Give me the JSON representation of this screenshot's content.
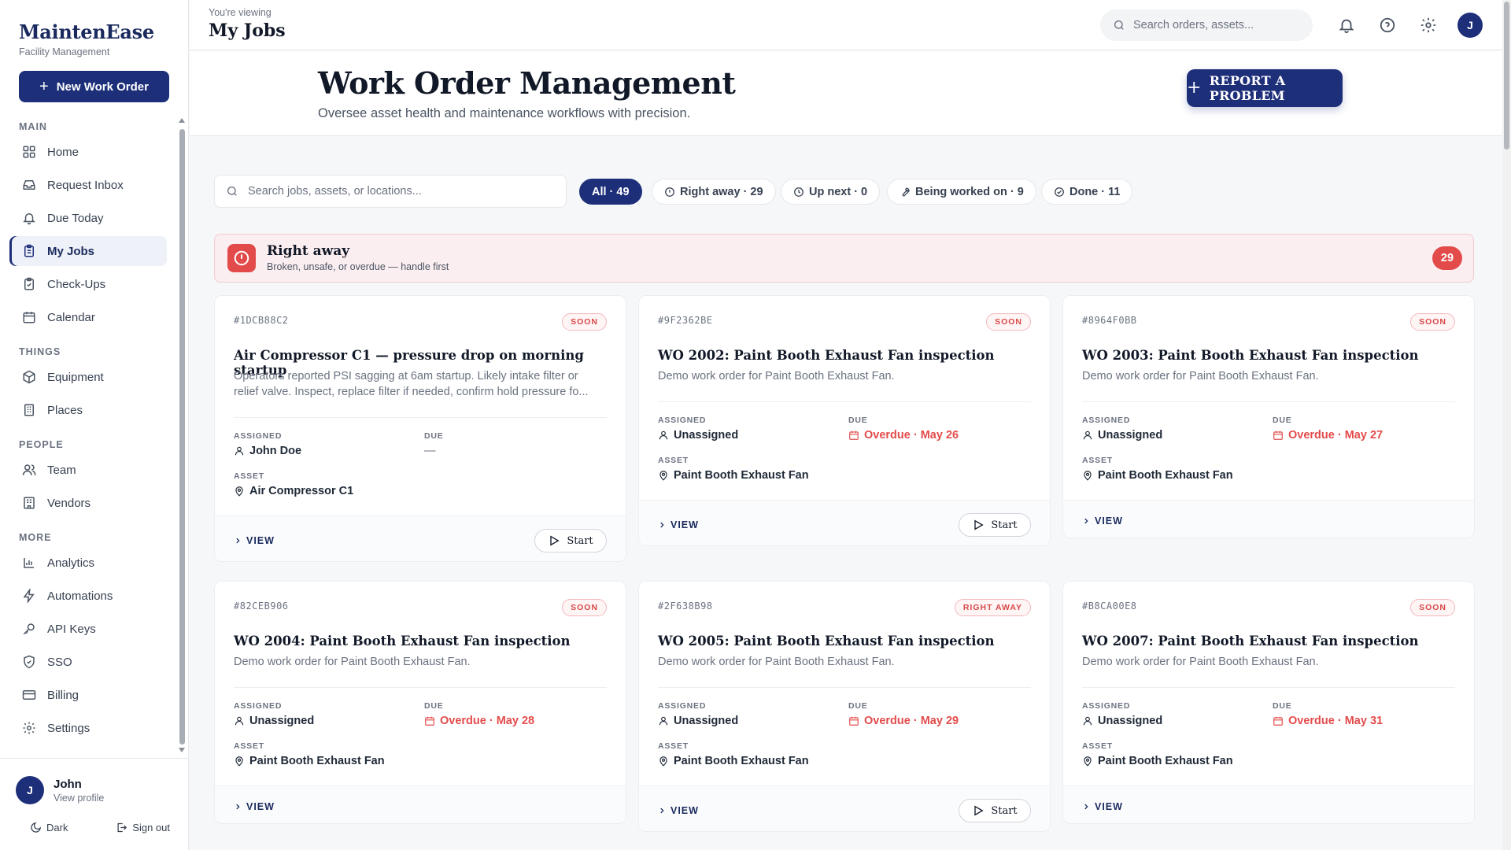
{
  "brand": {
    "name": "MaintenEase",
    "subtitle": "Facility Management"
  },
  "sidebar": {
    "new_button": "New Work Order",
    "sections": [
      {
        "label": "MAIN",
        "items": [
          {
            "label": "Home",
            "icon": "dashboard-grid-icon"
          },
          {
            "label": "Request Inbox",
            "icon": "inbox-icon"
          },
          {
            "label": "Due Today",
            "icon": "bell-icon"
          },
          {
            "label": "My Jobs",
            "icon": "clipboard-icon",
            "active": true
          },
          {
            "label": "Check-Ups",
            "icon": "clipboard-check-icon"
          },
          {
            "label": "Calendar",
            "icon": "calendar-icon"
          }
        ]
      },
      {
        "label": "THINGS",
        "items": [
          {
            "label": "Equipment",
            "icon": "box-icon"
          },
          {
            "label": "Places",
            "icon": "building-icon"
          }
        ]
      },
      {
        "label": "PEOPLE",
        "items": [
          {
            "label": "Team",
            "icon": "users-icon"
          },
          {
            "label": "Vendors",
            "icon": "vendor-building-icon"
          }
        ]
      },
      {
        "label": "MORE",
        "items": [
          {
            "label": "Analytics",
            "icon": "bar-chart-icon"
          },
          {
            "label": "Automations",
            "icon": "lightning-icon"
          },
          {
            "label": "API Keys",
            "icon": "key-icon"
          },
          {
            "label": "SSO",
            "icon": "shield-icon"
          },
          {
            "label": "Billing",
            "icon": "credit-card-icon"
          },
          {
            "label": "Settings",
            "icon": "gear-icon"
          }
        ]
      }
    ],
    "user": {
      "initial": "J",
      "name": "John",
      "link": "View profile"
    },
    "theme_toggle": "Dark",
    "sign_out": "Sign out"
  },
  "topbar": {
    "viewing_label": "You're viewing",
    "page_title": "My Jobs",
    "search_placeholder": "Search orders, assets...",
    "avatar_initial": "J"
  },
  "header": {
    "title": "Work Order Management",
    "subtitle": "Oversee asset health and maintenance workflows with precision.",
    "report_button": "REPORT A PROBLEM"
  },
  "filters": {
    "search_placeholder": "Search jobs, assets, or locations...",
    "pills": [
      {
        "label": "All · 49",
        "active": true
      },
      {
        "label": "Right away · 29",
        "icon": "alert-circle-icon"
      },
      {
        "label": "Up next · 0",
        "icon": "clock-icon"
      },
      {
        "label": "Being worked on · 9",
        "icon": "wrench-icon"
      },
      {
        "label": "Done · 11",
        "icon": "check-circle-icon"
      }
    ]
  },
  "banner": {
    "title": "Right away",
    "subtitle": "Broken, unsafe, or overdue — handle first",
    "count": "29"
  },
  "labels": {
    "assigned": "ASSIGNED",
    "due": "DUE",
    "asset": "ASSET",
    "view": "VIEW",
    "start": "Start"
  },
  "cards": [
    {
      "id": "#1DCB88C2",
      "badge": "SOON",
      "title": "Air Compressor C1 — pressure drop on morning startup",
      "desc": "Operators reported PSI sagging at 6am startup. Likely intake filter or relief valve. Inspect, replace filter if needed, confirm hold pressure fo...",
      "assigned": "John Doe",
      "due": "—",
      "asset": "Air Compressor C1",
      "start": true
    },
    {
      "id": "#9F2362BE",
      "badge": "SOON",
      "title": "WO 2002: Paint Booth Exhaust Fan inspection",
      "desc": "Demo work order for Paint Booth Exhaust Fan.",
      "assigned": "Unassigned",
      "due": "Overdue · May 26",
      "asset": "Paint Booth Exhaust Fan",
      "start": true
    },
    {
      "id": "#8964F0BB",
      "badge": "SOON",
      "title": "WO 2003: Paint Booth Exhaust Fan inspection",
      "desc": "Demo work order for Paint Booth Exhaust Fan.",
      "assigned": "Unassigned",
      "due": "Overdue · May 27",
      "asset": "Paint Booth Exhaust Fan",
      "start": false
    },
    {
      "id": "#82CEB906",
      "badge": "SOON",
      "title": "WO 2004: Paint Booth Exhaust Fan inspection",
      "desc": "Demo work order for Paint Booth Exhaust Fan.",
      "assigned": "Unassigned",
      "due": "Overdue · May 28",
      "asset": "Paint Booth Exhaust Fan",
      "start": false
    },
    {
      "id": "#2F638B98",
      "badge": "RIGHT AWAY",
      "title": "WO 2005: Paint Booth Exhaust Fan inspection",
      "desc": "Demo work order for Paint Booth Exhaust Fan.",
      "assigned": "Unassigned",
      "due": "Overdue · May 29",
      "asset": "Paint Booth Exhaust Fan",
      "start": true
    },
    {
      "id": "#B8CA00E8",
      "badge": "SOON",
      "title": "WO 2007: Paint Booth Exhaust Fan inspection",
      "desc": "Demo work order for Paint Booth Exhaust Fan.",
      "assigned": "Unassigned",
      "due": "Overdue · May 31",
      "asset": "Paint Booth Exhaust Fan",
      "start": false
    }
  ],
  "colors": {
    "primary": "#1e2f7a",
    "danger": "#e34b4b",
    "banner_bg": "#fbeef0"
  }
}
